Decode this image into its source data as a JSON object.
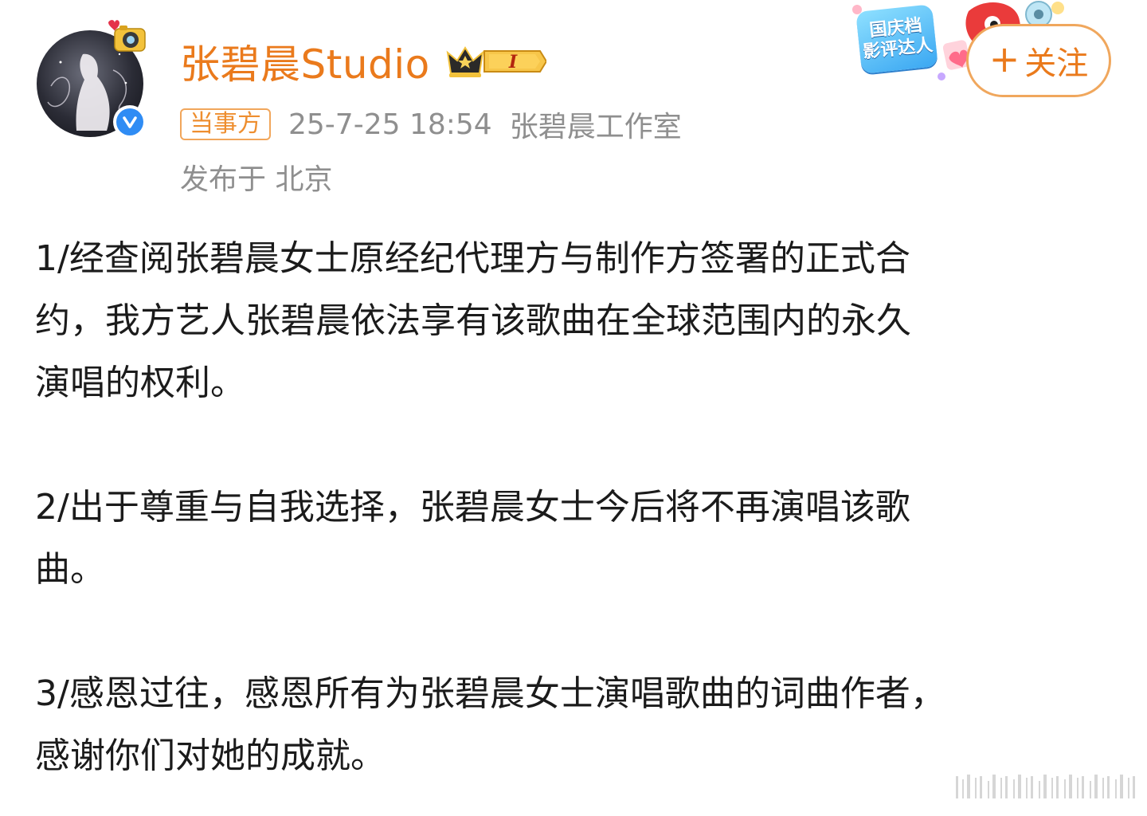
{
  "author": {
    "name": "张碧晨Studio",
    "vip_level": "I",
    "verified": true
  },
  "meta": {
    "party_tag": "当事方",
    "timestamp": "25-7-25 18:54",
    "source": "张碧晨工作室",
    "location": "发布于 北京"
  },
  "promo": {
    "line1": "国庆档",
    "line2": "影评达人"
  },
  "follow": {
    "plus": "+",
    "label": "关注"
  },
  "content": {
    "paragraphs": [
      {
        "lines": [
          "1/经查阅张碧晨女士原经纪代理方与制作方签署的正式合",
          "约，我方艺人张碧晨依法享有该歌曲在全球范围内的永久",
          "演唱的权利。"
        ]
      },
      {
        "lines": [
          "2/出于尊重与自我选择，张碧晨女士今后将不再演唱该歌",
          "曲。"
        ]
      },
      {
        "lines": [
          "3/感恩过往，感恩所有为张碧晨女士演唱歌曲的词曲作者，",
          "感谢你们对她的成就。"
        ]
      }
    ]
  },
  "colors": {
    "accent": "#ea7a1c",
    "meta_gray": "#8f8f8f",
    "verified_blue": "#2f8cf4"
  },
  "icons": [
    "camera-sticker-icon",
    "verified-icon",
    "crown-icon",
    "promo-sticker-icon",
    "watermark-icon"
  ]
}
